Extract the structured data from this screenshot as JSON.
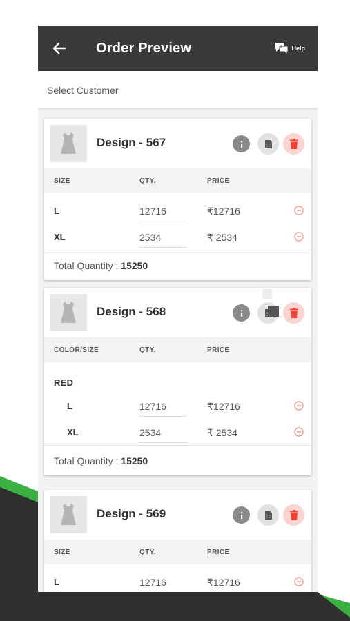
{
  "header": {
    "title": "Order Preview",
    "help_label": "Help"
  },
  "customer": {
    "label": "Select Customer"
  },
  "colors": {
    "appbar": "#3a3a3a",
    "accent_green": "#3cb043",
    "delete_red": "#f44336",
    "background_dark": "#2f2f2f"
  },
  "icons": {
    "back": "arrow-left-icon",
    "help": "chat-help-icon",
    "thumb": "dress-icon",
    "info": "info-icon",
    "doc": "document-icon",
    "delete": "trash-icon",
    "remove": "minus-circle-icon"
  },
  "cards": [
    {
      "title": "Design - 567",
      "headers": {
        "size": "SIZE",
        "qty": "QTY.",
        "price": "PRICE"
      },
      "rows": [
        {
          "size": "L",
          "qty": "12716",
          "price": "₹12716"
        },
        {
          "size": "XL",
          "qty": "2534",
          "price": "₹ 2534"
        }
      ],
      "total_label": "Total Quantity : ",
      "total_value": "15250"
    },
    {
      "title": "Design - 568",
      "headers": {
        "size": "COLOR/SIZE",
        "qty": "QTY.",
        "price": "PRICE"
      },
      "color": "RED",
      "rows": [
        {
          "size": "L",
          "qty": "12716",
          "price": "₹12716"
        },
        {
          "size": "XL",
          "qty": "2534",
          "price": "₹ 2534"
        }
      ],
      "total_label": "Total Quantity : ",
      "total_value": "15250"
    },
    {
      "title": "Design - 569",
      "headers": {
        "size": "SIZE",
        "qty": "QTY.",
        "price": "PRICE"
      },
      "rows": [
        {
          "size": "L",
          "qty": "12716",
          "price": "₹12716"
        }
      ]
    }
  ]
}
